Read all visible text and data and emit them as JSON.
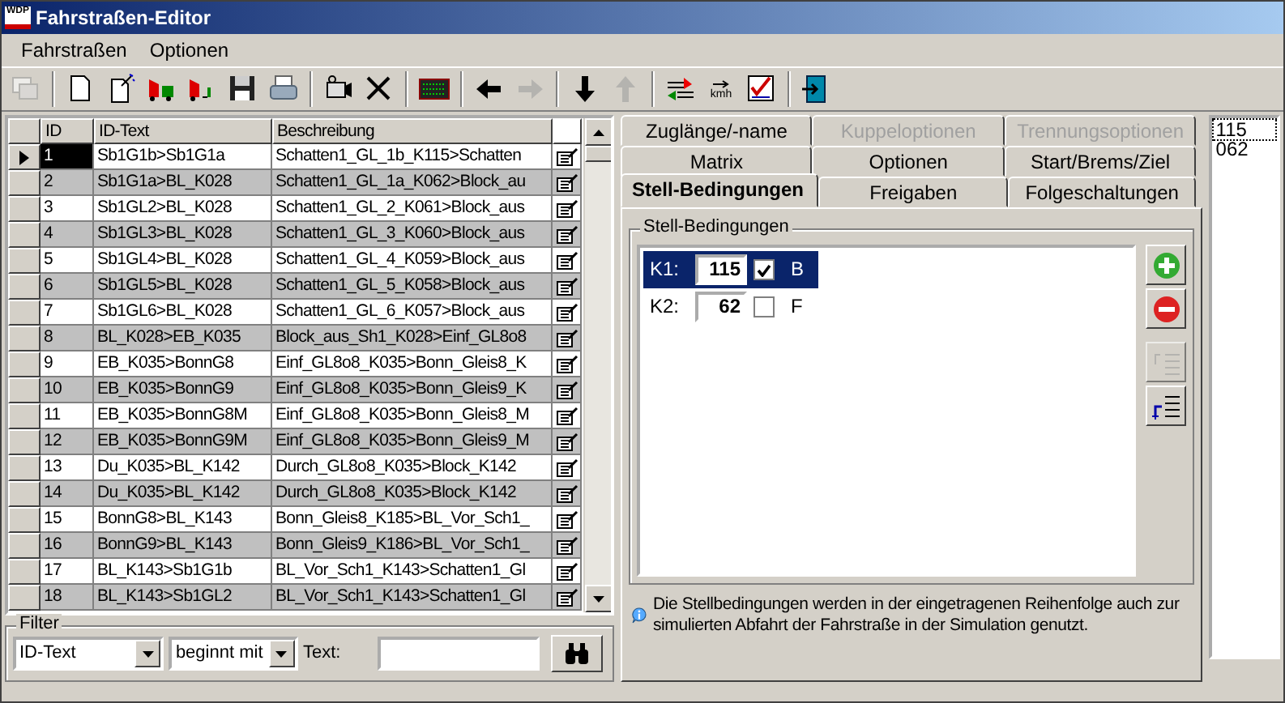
{
  "window": {
    "title": "Fahrstraßen-Editor",
    "app_icon_text": "WDP"
  },
  "menu": [
    {
      "label": "Fahrstraßen"
    },
    {
      "label": "Optionen"
    }
  ],
  "toolbar": [
    {
      "kind": "windows",
      "disabled": true
    },
    {
      "kind": "sep"
    },
    {
      "kind": "new",
      "disabled": false
    },
    {
      "kind": "wizard",
      "disabled": false
    },
    {
      "kind": "train",
      "disabled": false
    },
    {
      "kind": "train2",
      "disabled": false
    },
    {
      "kind": "save",
      "disabled": false
    },
    {
      "kind": "print",
      "disabled": false
    },
    {
      "kind": "sep"
    },
    {
      "kind": "camera",
      "disabled": false
    },
    {
      "kind": "delete",
      "disabled": false
    },
    {
      "kind": "sep"
    },
    {
      "kind": "matrix",
      "disabled": false
    },
    {
      "kind": "sep"
    },
    {
      "kind": "left",
      "disabled": false
    },
    {
      "kind": "right",
      "disabled": true
    },
    {
      "kind": "sep"
    },
    {
      "kind": "down",
      "disabled": false
    },
    {
      "kind": "up",
      "disabled": true
    },
    {
      "kind": "sep"
    },
    {
      "kind": "swap",
      "disabled": false
    },
    {
      "kind": "speed",
      "disabled": false,
      "label": "kmh"
    },
    {
      "kind": "check",
      "disabled": false
    },
    {
      "kind": "sep"
    },
    {
      "kind": "exit",
      "disabled": false
    }
  ],
  "grid": {
    "columns": [
      "ID",
      "ID-Text",
      "Beschreibung"
    ],
    "rows": [
      {
        "id": "1",
        "text": "Sb1G1b>Sb1G1a",
        "desc": "Schatten1_GL_1b_K115>Schatten",
        "selected": true
      },
      {
        "id": "2",
        "text": "Sb1G1a>BL_K028",
        "desc": "Schatten1_GL_1a_K062>Block_au",
        "selected": false
      },
      {
        "id": "3",
        "text": "Sb1GL2>BL_K028",
        "desc": "Schatten1_GL_2_K061>Block_aus",
        "selected": false
      },
      {
        "id": "4",
        "text": "Sb1GL3>BL_K028",
        "desc": "Schatten1_GL_3_K060>Block_aus",
        "selected": false
      },
      {
        "id": "5",
        "text": "Sb1GL4>BL_K028",
        "desc": "Schatten1_GL_4_K059>Block_aus",
        "selected": false
      },
      {
        "id": "6",
        "text": "Sb1GL5>BL_K028",
        "desc": "Schatten1_GL_5_K058>Block_aus",
        "selected": false
      },
      {
        "id": "7",
        "text": "Sb1GL6>BL_K028",
        "desc": "Schatten1_GL_6_K057>Block_aus",
        "selected": false
      },
      {
        "id": "8",
        "text": "BL_K028>EB_K035",
        "desc": "Block_aus_Sh1_K028>Einf_GL8o8",
        "selected": false
      },
      {
        "id": "9",
        "text": "EB_K035>BonnG8",
        "desc": "Einf_GL8o8_K035>Bonn_Gleis8_K",
        "selected": false
      },
      {
        "id": "10",
        "text": "EB_K035>BonnG9",
        "desc": "Einf_GL8o8_K035>Bonn_Gleis9_K",
        "selected": false
      },
      {
        "id": "11",
        "text": "EB_K035>BonnG8M",
        "desc": "Einf_GL8o8_K035>Bonn_Gleis8_M",
        "selected": false
      },
      {
        "id": "12",
        "text": "EB_K035>BonnG9M",
        "desc": "Einf_GL8o8_K035>Bonn_Gleis9_M",
        "selected": false
      },
      {
        "id": "13",
        "text": "Du_K035>BL_K142",
        "desc": "Durch_GL8o8_K035>Block_K142",
        "selected": false
      },
      {
        "id": "14",
        "text": "Du_K035>BL_K142",
        "desc": "Durch_GL8o8_K035>Block_K142",
        "selected": false
      },
      {
        "id": "15",
        "text": "BonnG8>BL_K143",
        "desc": "Bonn_Gleis8_K185>BL_Vor_Sch1_",
        "selected": false
      },
      {
        "id": "16",
        "text": "BonnG9>BL_K143",
        "desc": "Bonn_Gleis9_K186>BL_Vor_Sch1_",
        "selected": false
      },
      {
        "id": "17",
        "text": "BL_K143>Sb1G1b",
        "desc": "BL_Vor_Sch1_K143>Schatten1_Gl",
        "selected": false
      },
      {
        "id": "18",
        "text": "BL_K143>Sb1GL2",
        "desc": "BL_Vor_Sch1_K143>Schatten1_Gl",
        "selected": false
      }
    ]
  },
  "filter": {
    "title": "Filter",
    "field": "ID-Text",
    "mode": "beginnt mit",
    "text_label": "Text:"
  },
  "tab_rows": [
    [
      {
        "label": "Zuglänge/-name",
        "selected": false,
        "disabled": false
      },
      {
        "label": "Kuppeloptionen",
        "selected": false,
        "disabled": true
      },
      {
        "label": "Trennungsoptionen",
        "selected": false,
        "disabled": true
      }
    ],
    [
      {
        "label": "Matrix",
        "selected": false,
        "disabled": false
      },
      {
        "label": "Optionen",
        "selected": false,
        "disabled": false
      },
      {
        "label": "Start/Brems/Ziel",
        "selected": false,
        "disabled": false
      }
    ],
    [
      {
        "label": "Stell-Bedingungen",
        "selected": true,
        "disabled": false
      },
      {
        "label": "Freigaben",
        "selected": false,
        "disabled": false
      },
      {
        "label": "Folgeschaltungen",
        "selected": false,
        "disabled": false
      }
    ]
  ],
  "conditions": {
    "title": "Stell-Bedingungen",
    "items": [
      {
        "name": "K1:",
        "value": "115",
        "checked": true,
        "flag": "B",
        "selected": true
      },
      {
        "name": "K2:",
        "value": "62",
        "checked": false,
        "flag": "F",
        "selected": false
      }
    ],
    "buttons": [
      {
        "kind": "add",
        "disabled": false
      },
      {
        "kind": "remove",
        "disabled": false
      },
      {
        "kind": "move",
        "disabled": true
      },
      {
        "kind": "insert",
        "disabled": false
      }
    ]
  },
  "info": "Die Stellbedingungen werden in der eingetragenen Reihenfolge auch zur simulierten Abfahrt der Fahrstraße in der Simulation genutzt.",
  "listbox": [
    {
      "label": "115",
      "selected": true
    },
    {
      "label": "062",
      "selected": false
    }
  ]
}
